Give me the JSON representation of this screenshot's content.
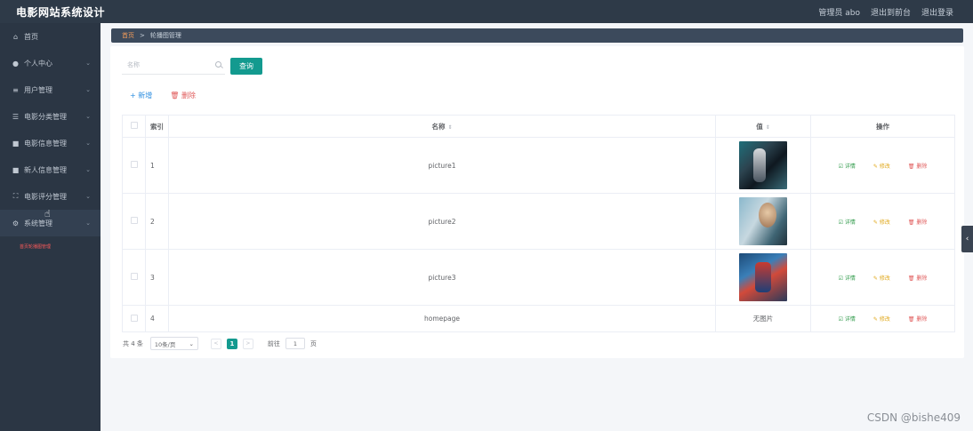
{
  "header": {
    "title": "电影网站系统设计",
    "user_label": "管理员 abo",
    "back_to_front": "退出到前台",
    "logout": "退出登录"
  },
  "sidebar": {
    "items": [
      {
        "label": "首页",
        "icon": "⌂"
      },
      {
        "label": "个人中心",
        "icon": "●"
      },
      {
        "label": "用户管理",
        "icon": "≡"
      },
      {
        "label": "电影分类管理",
        "icon": "☰"
      },
      {
        "label": "电影信息管理",
        "icon": "■"
      },
      {
        "label": "新人信息管理",
        "icon": "■"
      },
      {
        "label": "电影评分管理",
        "icon": "⛶"
      },
      {
        "label": "系统管理",
        "icon": "⚙"
      }
    ],
    "arrow": "⌄",
    "submenu_label": "首页轮播图管理"
  },
  "breadcrumb": {
    "home": "首页",
    "separator": ">",
    "current": "轮播图管理"
  },
  "search": {
    "placeholder": "名称",
    "button_label": "查询"
  },
  "actions": {
    "add": "+ 新增",
    "delete": "🗑 删除"
  },
  "table": {
    "headers": {
      "index": "索引",
      "name": "名称",
      "value": "值",
      "operations": "操作"
    },
    "sort_icon": "⇕",
    "rows": [
      {
        "index": "1",
        "name": "picture1",
        "value": "",
        "has_image": true
      },
      {
        "index": "2",
        "name": "picture2",
        "value": "",
        "has_image": true
      },
      {
        "index": "3",
        "name": "picture3",
        "value": "",
        "has_image": true
      },
      {
        "index": "4",
        "name": "homepage",
        "value": "无图片",
        "has_image": false
      }
    ],
    "op_labels": {
      "detail": "☑ 详情",
      "edit": "✎ 修改",
      "delete": "🗑 删除"
    }
  },
  "pagination": {
    "total": "共 4 条",
    "page_size": "10条/页",
    "page_size_arrow": "⌄",
    "prev": "<",
    "current_page": "1",
    "next": ">",
    "goto_label": "前往",
    "goto_value": "1",
    "page_unit": "页"
  },
  "side_toggle": "‹",
  "watermark": "CSDN @bishe409"
}
